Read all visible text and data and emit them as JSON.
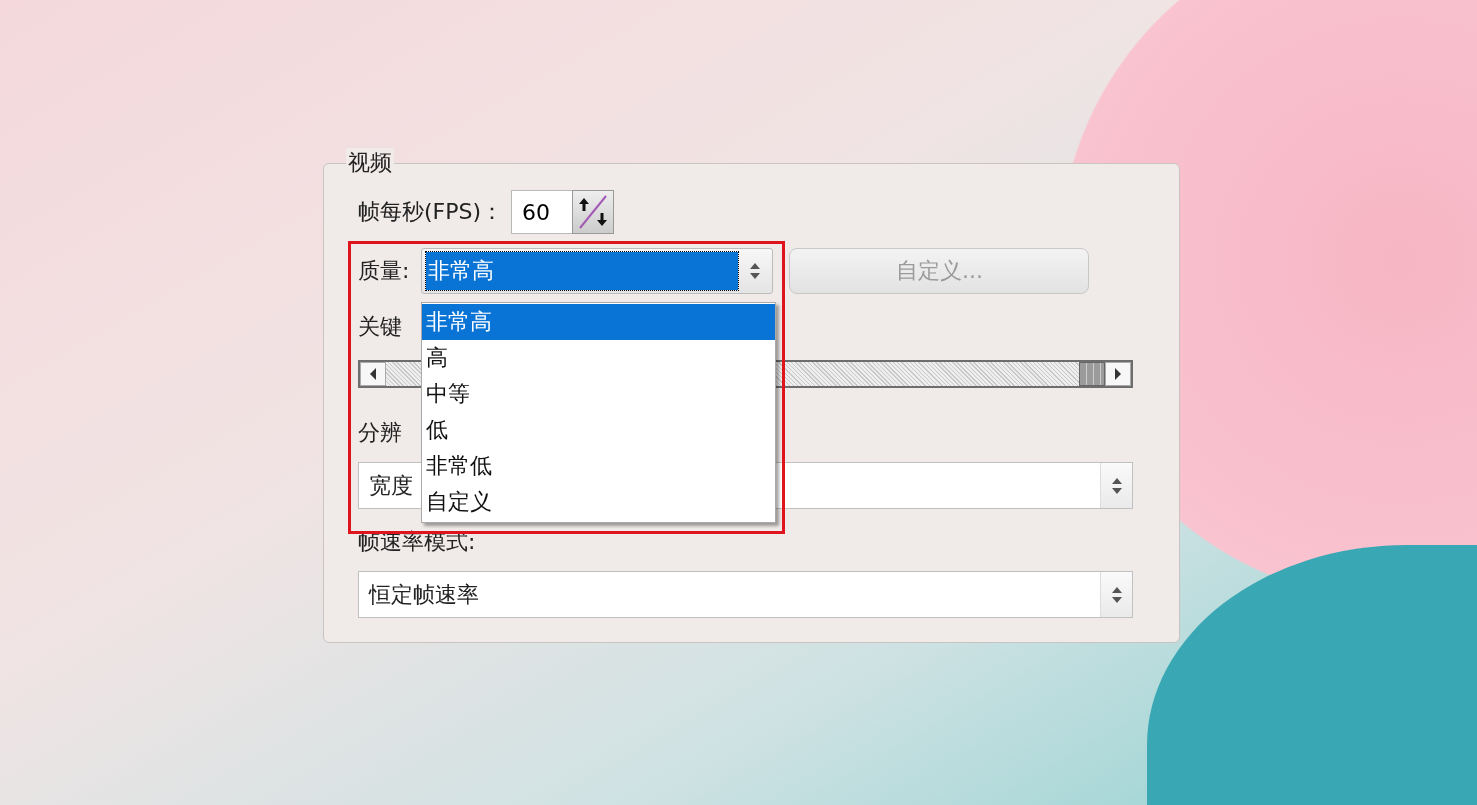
{
  "group": {
    "title": "视频"
  },
  "fps": {
    "label": "帧每秒(FPS)：",
    "value": "60"
  },
  "quality": {
    "label": "质量:",
    "value": "非常高",
    "options": [
      {
        "label": "非常高",
        "selected": true
      },
      {
        "label": "高",
        "selected": false
      },
      {
        "label": "中等",
        "selected": false
      },
      {
        "label": "低",
        "selected": false
      },
      {
        "label": "非常低",
        "selected": false
      },
      {
        "label": "自定义",
        "selected": false
      }
    ],
    "custom_button": {
      "label": "自定义...",
      "disabled": true
    }
  },
  "keyframe": {
    "label": "关键"
  },
  "keyframe_slider": {
    "level": 1
  },
  "resolution": {
    "label": "分辨",
    "value": "宽度"
  },
  "frame_rate_mode": {
    "label": "帧速率模式:",
    "value": "恒定帧速率"
  }
}
